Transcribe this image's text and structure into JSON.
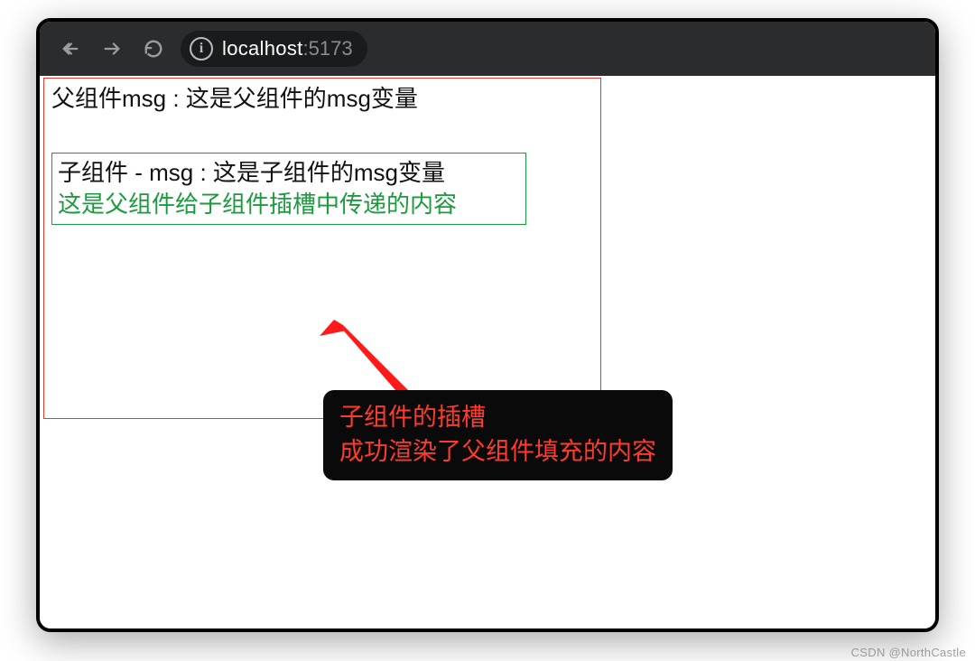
{
  "browser": {
    "url_host": "localhost",
    "url_port": ":5173"
  },
  "page": {
    "parent_msg": "父组件msg : 这是父组件的msg变量",
    "child_msg": "子组件 - msg : 这是子组件的msg变量",
    "slot_content": "这是父组件给子组件插槽中传递的内容"
  },
  "annotation": {
    "line1": "子组件的插槽",
    "line2": "成功渲染了父组件填充的内容"
  },
  "watermark": "CSDN @NorthCastle",
  "colors": {
    "parent_border": "#e23a2b",
    "child_border": "#1a9b3d",
    "slot_text": "#1a9b3d",
    "annotation_bg": "#0a0a0a",
    "annotation_text": "#ff3b2e",
    "browser_bar_bg": "#2a2c2e",
    "address_bar_bg": "#1a1b1c"
  }
}
